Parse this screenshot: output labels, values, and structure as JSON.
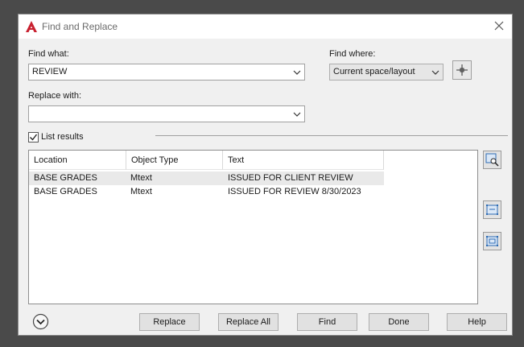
{
  "window": {
    "title": "Find and Replace"
  },
  "find_what": {
    "label": "Find what:",
    "value": "REVIEW"
  },
  "find_where": {
    "label": "Find where:",
    "value": "Current space/layout"
  },
  "replace_with": {
    "label": "Replace with:",
    "value": ""
  },
  "list_results": {
    "label": "List results",
    "checked": true
  },
  "results": {
    "columns": [
      "Location",
      "Object Type",
      "Text"
    ],
    "rows": [
      {
        "location": "BASE GRADES",
        "object_type": "Mtext",
        "text": "ISSUED FOR CLIENT REVIEW"
      },
      {
        "location": "BASE GRADES",
        "object_type": "Mtext",
        "text": "ISSUED FOR REVIEW 8/30/2023"
      }
    ]
  },
  "buttons": {
    "replace": "Replace",
    "replace_all": "Replace All",
    "find": "Find",
    "done": "Done",
    "help": "Help"
  },
  "icons": {
    "logo": "autocad-logo-icon",
    "close": "close-icon",
    "dropdown": "chevron-down-icon",
    "select_objects": "crosshair-icon",
    "zoom_to": "zoom-to-object-icon",
    "create_selection": "create-selection-set-icon",
    "create_selection_all": "create-selection-set-all-icon",
    "expand": "expand-options-icon"
  },
  "colors": {
    "logo_red": "#c8202f",
    "selected_row": "#e9e9e9",
    "icon_blue": "#2f6db5"
  }
}
